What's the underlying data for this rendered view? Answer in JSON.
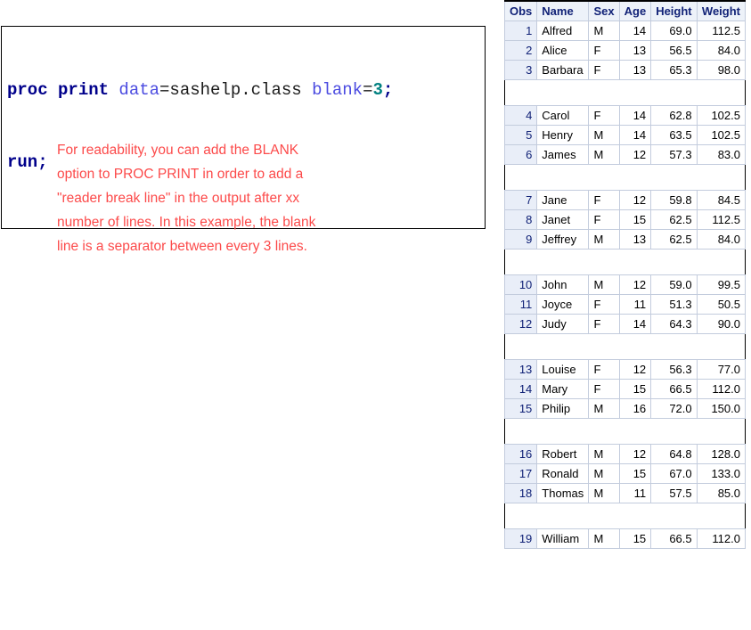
{
  "code_block": {
    "lines": [
      [
        {
          "text": "proc print ",
          "kind": "kw"
        },
        {
          "text": "data",
          "kind": "opt"
        },
        {
          "text": "=sashelp.class ",
          "kind": "plain"
        },
        {
          "text": "blank",
          "kind": "opt"
        },
        {
          "text": "=",
          "kind": "plain"
        },
        {
          "text": "3",
          "kind": "num"
        },
        {
          "text": ";",
          "kind": "punct"
        }
      ],
      [
        {
          "text": "run",
          "kind": "kw"
        },
        {
          "text": ";",
          "kind": "punct"
        }
      ]
    ]
  },
  "annotation": {
    "color": "#fc4a4a",
    "lines": [
      "For readability, you can add the BLANK",
      "option to PROC PRINT in order to add a",
      "\"reader break line\" in the output after xx",
      "number of lines. In this example, the blank",
      "line is a separator between every 3 lines."
    ]
  },
  "table": {
    "headers": [
      "Obs",
      "Name",
      "Sex",
      "Age",
      "Height",
      "Weight"
    ],
    "header_bg": "#edf2f9",
    "header_color": "#112277",
    "obs_cell_bg": "#e9eef8",
    "grid_color": "#c3ccdd",
    "blank_every": 3,
    "rows": [
      {
        "obs": "1",
        "name": "Alfred",
        "sex": "M",
        "age": "14",
        "height": "69.0",
        "weight": "112.5"
      },
      {
        "obs": "2",
        "name": "Alice",
        "sex": "F",
        "age": "13",
        "height": "56.5",
        "weight": "84.0"
      },
      {
        "obs": "3",
        "name": "Barbara",
        "sex": "F",
        "age": "13",
        "height": "65.3",
        "weight": "98.0"
      },
      {
        "blank": true
      },
      {
        "obs": "4",
        "name": "Carol",
        "sex": "F",
        "age": "14",
        "height": "62.8",
        "weight": "102.5"
      },
      {
        "obs": "5",
        "name": "Henry",
        "sex": "M",
        "age": "14",
        "height": "63.5",
        "weight": "102.5"
      },
      {
        "obs": "6",
        "name": "James",
        "sex": "M",
        "age": "12",
        "height": "57.3",
        "weight": "83.0"
      },
      {
        "blank": true
      },
      {
        "obs": "7",
        "name": "Jane",
        "sex": "F",
        "age": "12",
        "height": "59.8",
        "weight": "84.5"
      },
      {
        "obs": "8",
        "name": "Janet",
        "sex": "F",
        "age": "15",
        "height": "62.5",
        "weight": "112.5"
      },
      {
        "obs": "9",
        "name": "Jeffrey",
        "sex": "M",
        "age": "13",
        "height": "62.5",
        "weight": "84.0"
      },
      {
        "blank": true
      },
      {
        "obs": "10",
        "name": "John",
        "sex": "M",
        "age": "12",
        "height": "59.0",
        "weight": "99.5"
      },
      {
        "obs": "11",
        "name": "Joyce",
        "sex": "F",
        "age": "11",
        "height": "51.3",
        "weight": "50.5"
      },
      {
        "obs": "12",
        "name": "Judy",
        "sex": "F",
        "age": "14",
        "height": "64.3",
        "weight": "90.0"
      },
      {
        "blank": true
      },
      {
        "obs": "13",
        "name": "Louise",
        "sex": "F",
        "age": "12",
        "height": "56.3",
        "weight": "77.0"
      },
      {
        "obs": "14",
        "name": "Mary",
        "sex": "F",
        "age": "15",
        "height": "66.5",
        "weight": "112.0"
      },
      {
        "obs": "15",
        "name": "Philip",
        "sex": "M",
        "age": "16",
        "height": "72.0",
        "weight": "150.0"
      },
      {
        "blank": true
      },
      {
        "obs": "16",
        "name": "Robert",
        "sex": "M",
        "age": "12",
        "height": "64.8",
        "weight": "128.0"
      },
      {
        "obs": "17",
        "name": "Ronald",
        "sex": "M",
        "age": "15",
        "height": "67.0",
        "weight": "133.0"
      },
      {
        "obs": "18",
        "name": "Thomas",
        "sex": "M",
        "age": "11",
        "height": "57.5",
        "weight": "85.0"
      },
      {
        "blank": true
      },
      {
        "obs": "19",
        "name": "William",
        "sex": "M",
        "age": "15",
        "height": "66.5",
        "weight": "112.0"
      }
    ]
  }
}
